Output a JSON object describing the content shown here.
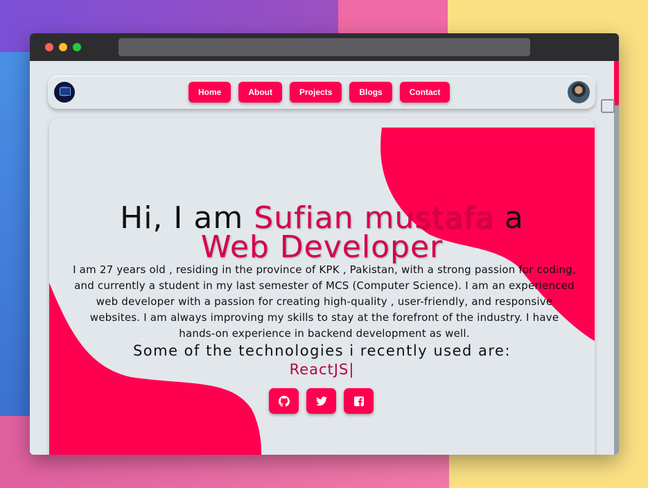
{
  "nav": {
    "items": [
      {
        "label": "Home"
      },
      {
        "label": "About"
      },
      {
        "label": "Projects"
      },
      {
        "label": "Blogs"
      },
      {
        "label": "Contact"
      }
    ]
  },
  "hero": {
    "greeting": "Hi, I am ",
    "name": " Sufian mustafa ",
    "connector": " a",
    "role": "Web Developer",
    "bio": "I am 27 years old , residing in the province of KPK , Pakistan, with a strong passion for coding, and currently a student in my last semester of MCS (Computer Science). I am an experienced web developer with a passion for creating high-quality , user-friendly, and responsive websites. I am always improving my skills to stay at the forefront of the industry. I have hands-on experience in backend development as well.",
    "tech_heading": "Some of the technologies i recently used are:",
    "typed_text": "ReactJS|"
  },
  "socials": [
    {
      "icon": "github-icon"
    },
    {
      "icon": "twitter-icon"
    },
    {
      "icon": "facebook-icon"
    }
  ],
  "colors": {
    "accent": "#ff0050",
    "accent_dark": "#d6024a",
    "page_bg": "#e2e7ec"
  }
}
